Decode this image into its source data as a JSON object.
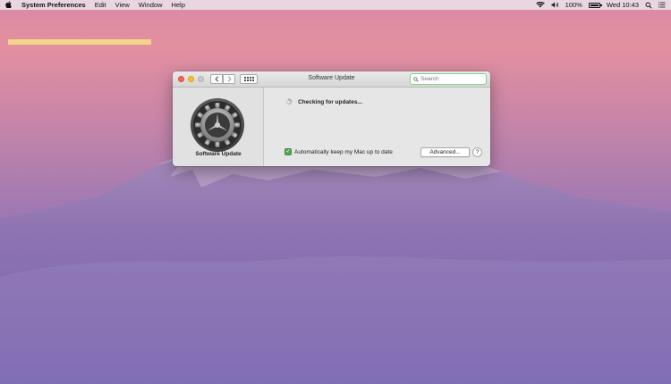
{
  "menubar": {
    "apple_icon": "apple-icon",
    "app_name": "System Preferences",
    "menus": [
      "Edit",
      "View",
      "Window",
      "Help"
    ],
    "battery_percent": "100%",
    "battery_level": 1.0,
    "clock": "Wed 10:43"
  },
  "window": {
    "title": "Software Update",
    "search_placeholder": "Search",
    "pane_label": "Software Update",
    "status_text": "Checking for updates...",
    "auto_update_label": "Automatically keep my Mac up to date",
    "auto_update_checked": true,
    "advanced_label": "Advanced...",
    "help_label": "?"
  },
  "colors": {
    "close": "#fc5f57",
    "minimize": "#fdbc2e",
    "search_focus": "#7fd27f",
    "checkbox": "#55a759",
    "highlight_bar": "#f2d58a"
  }
}
